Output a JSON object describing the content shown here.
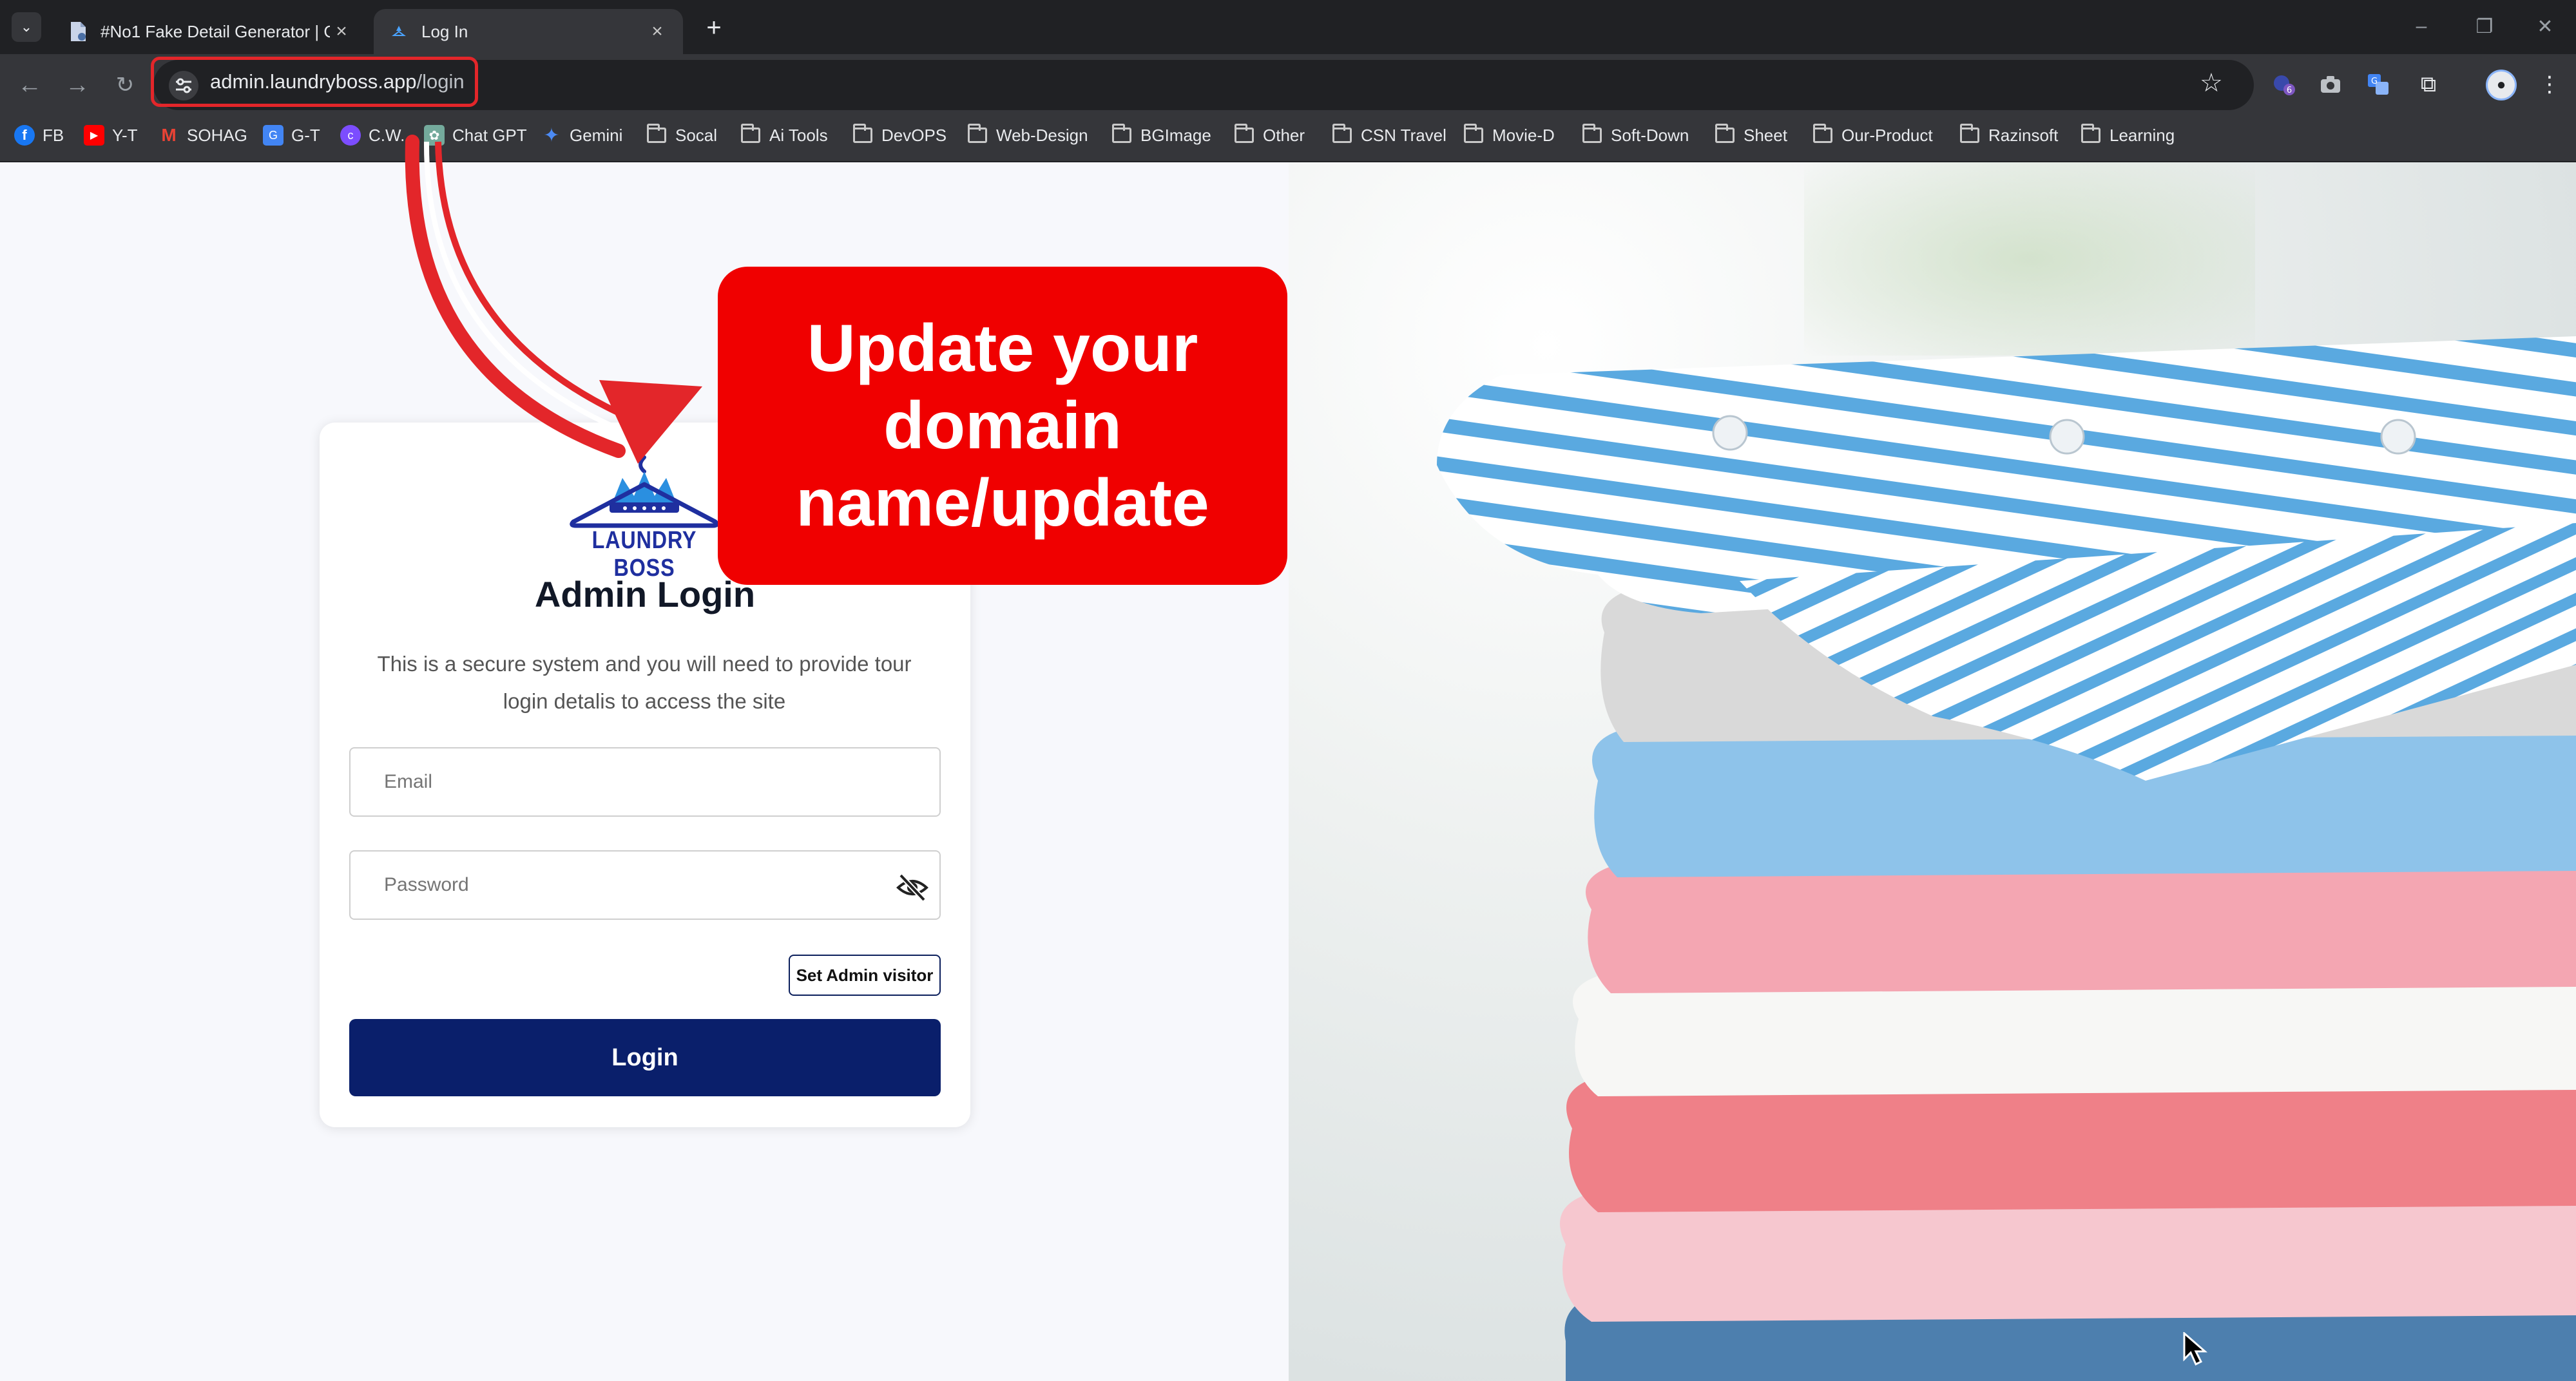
{
  "browser": {
    "tabs": [
      {
        "title": "#No1 Fake Detail Generator | G",
        "favicon": "document-icon",
        "active": false
      },
      {
        "title": "Log In",
        "favicon": "laundry-favicon",
        "active": true
      }
    ],
    "url_host": "admin.laundryboss.app",
    "url_path": "/login",
    "extension_badge": "6",
    "bookmarks": [
      {
        "label": "FB",
        "icon": "facebook-icon",
        "color": "#1877f2"
      },
      {
        "label": "Y-T",
        "icon": "youtube-icon",
        "color": "#ff0000"
      },
      {
        "label": "SOHAG",
        "icon": "gmail-icon",
        "color": "#ea4335"
      },
      {
        "label": "G-T",
        "icon": "translate-icon",
        "color": "#4285f4"
      },
      {
        "label": "C.W.",
        "icon": "cw-icon",
        "color": "#7c4dff"
      },
      {
        "label": "Chat GPT",
        "icon": "chatgpt-icon",
        "color": "#74aa9c"
      },
      {
        "label": "Gemini",
        "icon": "gemini-icon",
        "color": "#4c8bf5"
      },
      {
        "label": "Socal",
        "icon": "folder-icon"
      },
      {
        "label": "Ai Tools",
        "icon": "folder-icon"
      },
      {
        "label": "DevOPS",
        "icon": "folder-icon"
      },
      {
        "label": "Web-Design",
        "icon": "folder-icon"
      },
      {
        "label": "BGImage",
        "icon": "folder-icon"
      },
      {
        "label": "Other",
        "icon": "folder-icon"
      },
      {
        "label": "CSN Travel",
        "icon": "folder-icon"
      },
      {
        "label": "Movie-D",
        "icon": "folder-icon"
      },
      {
        "label": "Soft-Down",
        "icon": "folder-icon"
      },
      {
        "label": "Sheet",
        "icon": "folder-icon"
      },
      {
        "label": "Our-Product",
        "icon": "folder-icon"
      },
      {
        "label": "Razinsoft",
        "icon": "folder-icon"
      },
      {
        "label": "Learning",
        "icon": "folder-icon"
      }
    ]
  },
  "login": {
    "logo_text": "LAUNDRY BOSS",
    "title": "Admin Login",
    "subtitle": "This is a secure system and you will need to provide tour login detalis to access the site",
    "email_placeholder": "Email",
    "password_placeholder": "Password",
    "visitor_button": "Set Admin visitor",
    "login_button": "Login"
  },
  "annotation": {
    "callout_text": "Update your domain name/update",
    "color": "#f00000"
  },
  "colors": {
    "primary": "#0a1f6b",
    "logo_blue": "#1f2f9f",
    "chrome_dark": "#202124",
    "chrome_toolbar": "#35363a"
  }
}
